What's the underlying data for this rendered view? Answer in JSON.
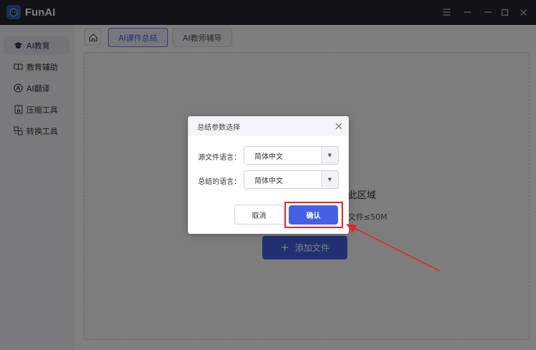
{
  "app": {
    "title": "FunAI"
  },
  "window_controls": [
    {
      "icon": "menu-icon"
    },
    {
      "icon": "minimize-icon"
    },
    {
      "icon": "maximize-icon"
    },
    {
      "icon": "close-icon"
    }
  ],
  "sidebar": {
    "items": [
      {
        "label": "AI教育",
        "icon": "graduation-cap-icon",
        "active": true
      },
      {
        "label": "教育辅助",
        "icon": "open-book-icon",
        "active": false
      },
      {
        "label": "AI翻译",
        "icon": "translate-icon",
        "active": false
      },
      {
        "label": "压缩工具",
        "icon": "archive-icon",
        "active": false
      },
      {
        "label": "转换工具",
        "icon": "convert-icon",
        "active": false
      }
    ]
  },
  "tabs": [
    {
      "label": "AI课件总结",
      "active": true
    },
    {
      "label": "AI教师辅导",
      "active": false
    }
  ],
  "upload": {
    "hint_text": "此区域",
    "size_hint": "文件≤50M",
    "add_button": "添加文件"
  },
  "dialog": {
    "title": "总结参数选择",
    "fields": [
      {
        "label": "源文件语言：",
        "value": "简体中文"
      },
      {
        "label": "总结的语言：",
        "value": "简体中文"
      }
    ],
    "cancel": "取消",
    "confirm": "确认"
  },
  "colors": {
    "accent": "#4461e6",
    "titlebar": "#23262e",
    "annotation": "#e0262a"
  }
}
